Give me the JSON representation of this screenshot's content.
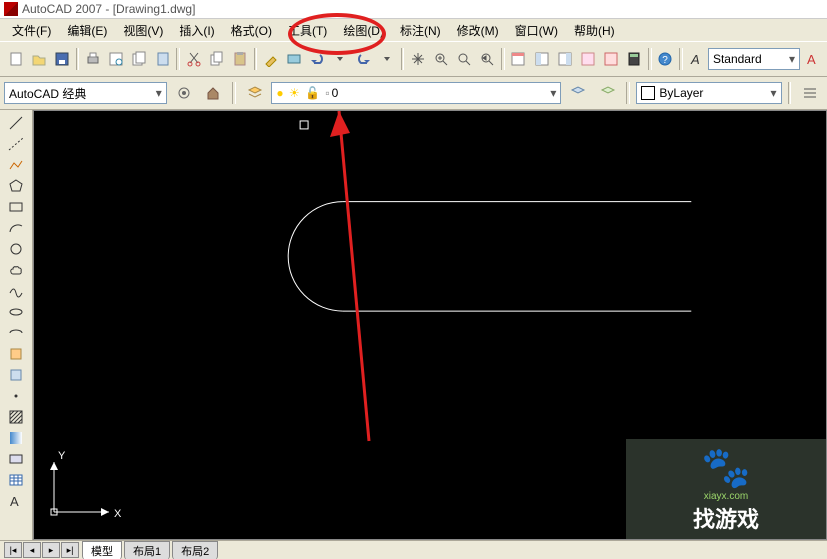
{
  "title": "AutoCAD 2007 - [Drawing1.dwg]",
  "menu": {
    "file": "文件(F)",
    "edit": "编辑(E)",
    "view": "视图(V)",
    "insert": "插入(I)",
    "format": "格式(O)",
    "tools": "工具(T)",
    "draw": "绘图(D)",
    "dimension": "标注(N)",
    "modify": "修改(M)",
    "window": "窗口(W)",
    "help": "帮助(H)"
  },
  "workspace": "AutoCAD 经典",
  "layer": {
    "current": "0"
  },
  "style": "Standard",
  "linetype": "ByLayer",
  "tabs": {
    "model": "模型",
    "layout1": "布局1",
    "layout2": "布局2"
  },
  "ucs": {
    "x": "X",
    "y": "Y"
  },
  "watermark": {
    "site": "xiayx.com",
    "brand": "找游戏"
  }
}
